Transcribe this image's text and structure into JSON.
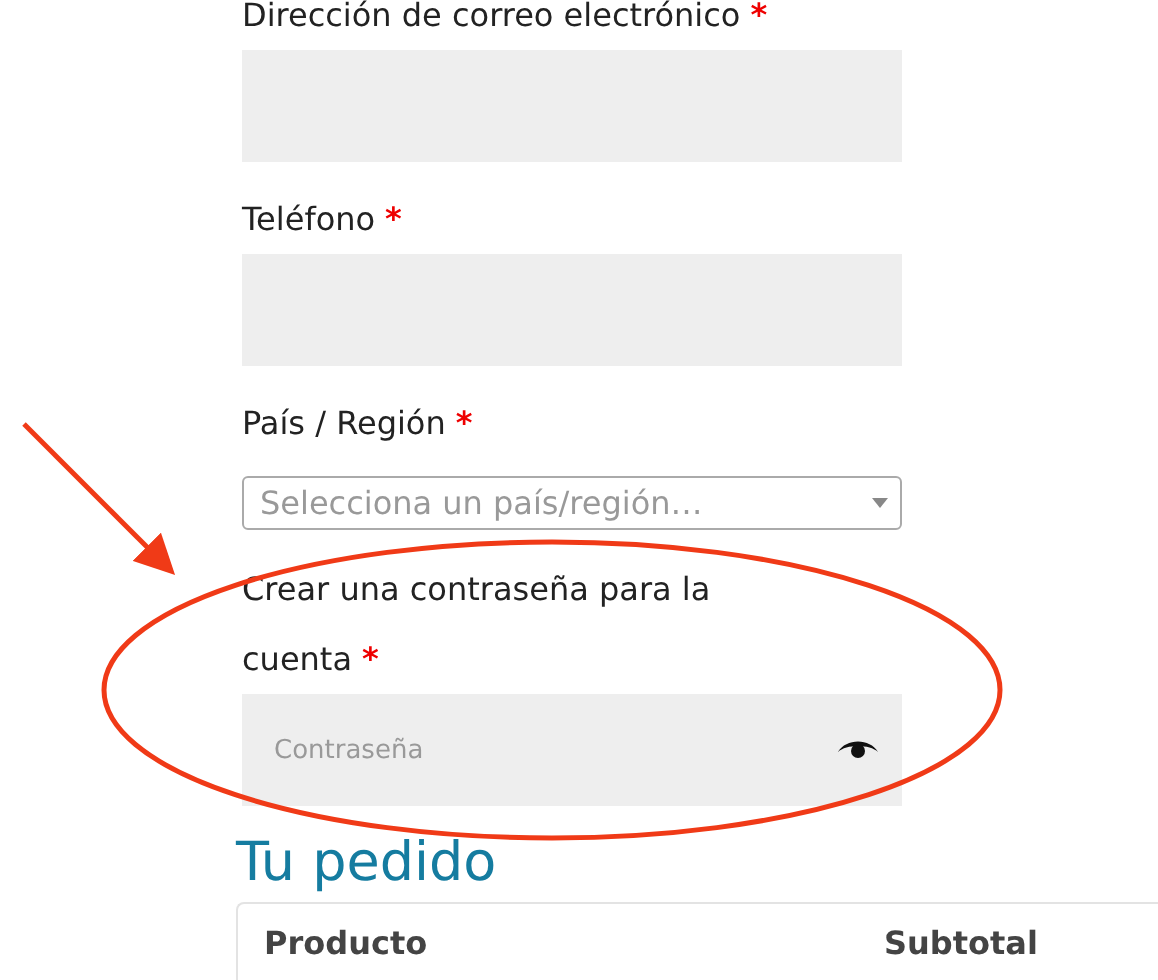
{
  "fields": [
    {
      "kind": "text",
      "label": "Dirección de correo electrónico",
      "required_mark": "*"
    },
    {
      "kind": "text",
      "label": "Teléfono",
      "required_mark": "*"
    },
    {
      "kind": "select",
      "label": "País / Región",
      "required_mark": "*",
      "placeholder": "Selecciona un país/región…"
    },
    {
      "kind": "password",
      "label": "Crear una contraseña para la cuenta",
      "required_mark": "*",
      "placeholder": "Contraseña"
    }
  ],
  "order": {
    "title": "Tu pedido",
    "columns": [
      "Producto",
      "Subtotal"
    ]
  },
  "annotations": [
    {
      "kind": "arrow"
    },
    {
      "kind": "ellipse"
    }
  ]
}
